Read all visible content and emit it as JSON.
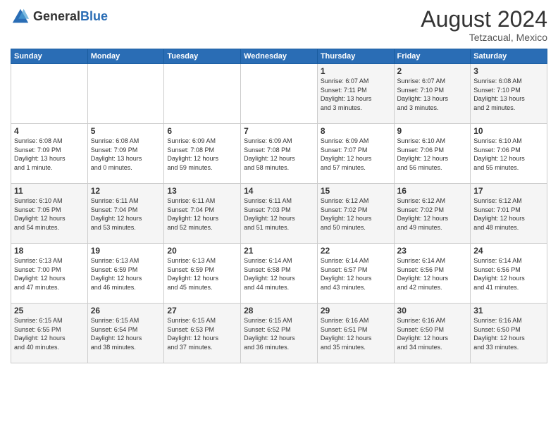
{
  "header": {
    "logo_line1": "General",
    "logo_line2": "Blue",
    "month_year": "August 2024",
    "location": "Tetzacual, Mexico"
  },
  "days_of_week": [
    "Sunday",
    "Monday",
    "Tuesday",
    "Wednesday",
    "Thursday",
    "Friday",
    "Saturday"
  ],
  "weeks": [
    [
      {
        "day": "",
        "info": ""
      },
      {
        "day": "",
        "info": ""
      },
      {
        "day": "",
        "info": ""
      },
      {
        "day": "",
        "info": ""
      },
      {
        "day": "1",
        "info": "Sunrise: 6:07 AM\nSunset: 7:11 PM\nDaylight: 13 hours\nand 3 minutes."
      },
      {
        "day": "2",
        "info": "Sunrise: 6:07 AM\nSunset: 7:10 PM\nDaylight: 13 hours\nand 3 minutes."
      },
      {
        "day": "3",
        "info": "Sunrise: 6:08 AM\nSunset: 7:10 PM\nDaylight: 13 hours\nand 2 minutes."
      }
    ],
    [
      {
        "day": "4",
        "info": "Sunrise: 6:08 AM\nSunset: 7:09 PM\nDaylight: 13 hours\nand 1 minute."
      },
      {
        "day": "5",
        "info": "Sunrise: 6:08 AM\nSunset: 7:09 PM\nDaylight: 13 hours\nand 0 minutes."
      },
      {
        "day": "6",
        "info": "Sunrise: 6:09 AM\nSunset: 7:08 PM\nDaylight: 12 hours\nand 59 minutes."
      },
      {
        "day": "7",
        "info": "Sunrise: 6:09 AM\nSunset: 7:08 PM\nDaylight: 12 hours\nand 58 minutes."
      },
      {
        "day": "8",
        "info": "Sunrise: 6:09 AM\nSunset: 7:07 PM\nDaylight: 12 hours\nand 57 minutes."
      },
      {
        "day": "9",
        "info": "Sunrise: 6:10 AM\nSunset: 7:06 PM\nDaylight: 12 hours\nand 56 minutes."
      },
      {
        "day": "10",
        "info": "Sunrise: 6:10 AM\nSunset: 7:06 PM\nDaylight: 12 hours\nand 55 minutes."
      }
    ],
    [
      {
        "day": "11",
        "info": "Sunrise: 6:10 AM\nSunset: 7:05 PM\nDaylight: 12 hours\nand 54 minutes."
      },
      {
        "day": "12",
        "info": "Sunrise: 6:11 AM\nSunset: 7:04 PM\nDaylight: 12 hours\nand 53 minutes."
      },
      {
        "day": "13",
        "info": "Sunrise: 6:11 AM\nSunset: 7:04 PM\nDaylight: 12 hours\nand 52 minutes."
      },
      {
        "day": "14",
        "info": "Sunrise: 6:11 AM\nSunset: 7:03 PM\nDaylight: 12 hours\nand 51 minutes."
      },
      {
        "day": "15",
        "info": "Sunrise: 6:12 AM\nSunset: 7:02 PM\nDaylight: 12 hours\nand 50 minutes."
      },
      {
        "day": "16",
        "info": "Sunrise: 6:12 AM\nSunset: 7:02 PM\nDaylight: 12 hours\nand 49 minutes."
      },
      {
        "day": "17",
        "info": "Sunrise: 6:12 AM\nSunset: 7:01 PM\nDaylight: 12 hours\nand 48 minutes."
      }
    ],
    [
      {
        "day": "18",
        "info": "Sunrise: 6:13 AM\nSunset: 7:00 PM\nDaylight: 12 hours\nand 47 minutes."
      },
      {
        "day": "19",
        "info": "Sunrise: 6:13 AM\nSunset: 6:59 PM\nDaylight: 12 hours\nand 46 minutes."
      },
      {
        "day": "20",
        "info": "Sunrise: 6:13 AM\nSunset: 6:59 PM\nDaylight: 12 hours\nand 45 minutes."
      },
      {
        "day": "21",
        "info": "Sunrise: 6:14 AM\nSunset: 6:58 PM\nDaylight: 12 hours\nand 44 minutes."
      },
      {
        "day": "22",
        "info": "Sunrise: 6:14 AM\nSunset: 6:57 PM\nDaylight: 12 hours\nand 43 minutes."
      },
      {
        "day": "23",
        "info": "Sunrise: 6:14 AM\nSunset: 6:56 PM\nDaylight: 12 hours\nand 42 minutes."
      },
      {
        "day": "24",
        "info": "Sunrise: 6:14 AM\nSunset: 6:56 PM\nDaylight: 12 hours\nand 41 minutes."
      }
    ],
    [
      {
        "day": "25",
        "info": "Sunrise: 6:15 AM\nSunset: 6:55 PM\nDaylight: 12 hours\nand 40 minutes."
      },
      {
        "day": "26",
        "info": "Sunrise: 6:15 AM\nSunset: 6:54 PM\nDaylight: 12 hours\nand 38 minutes."
      },
      {
        "day": "27",
        "info": "Sunrise: 6:15 AM\nSunset: 6:53 PM\nDaylight: 12 hours\nand 37 minutes."
      },
      {
        "day": "28",
        "info": "Sunrise: 6:15 AM\nSunset: 6:52 PM\nDaylight: 12 hours\nand 36 minutes."
      },
      {
        "day": "29",
        "info": "Sunrise: 6:16 AM\nSunset: 6:51 PM\nDaylight: 12 hours\nand 35 minutes."
      },
      {
        "day": "30",
        "info": "Sunrise: 6:16 AM\nSunset: 6:50 PM\nDaylight: 12 hours\nand 34 minutes."
      },
      {
        "day": "31",
        "info": "Sunrise: 6:16 AM\nSunset: 6:50 PM\nDaylight: 12 hours\nand 33 minutes."
      }
    ]
  ]
}
